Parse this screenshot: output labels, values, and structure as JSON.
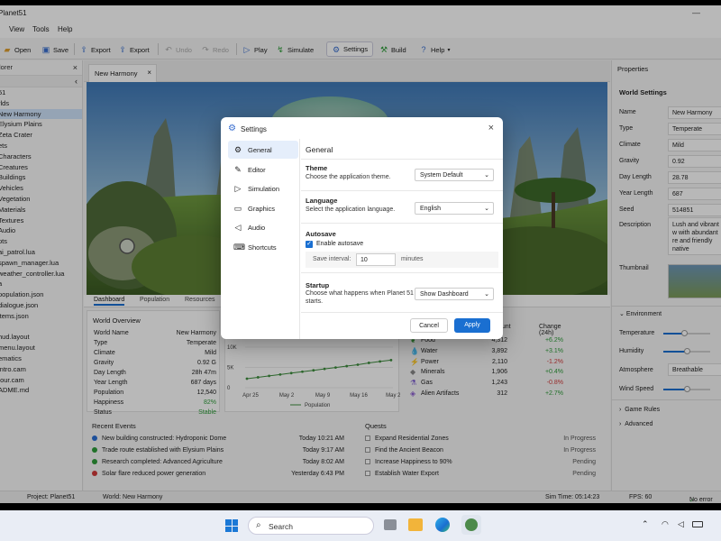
{
  "window": {
    "title": "Planet51"
  },
  "menu": [
    "View",
    "Tools",
    "Help"
  ],
  "toolbar": {
    "open": "Open",
    "save": "Save",
    "export1": "Export",
    "export2": "Export",
    "undo": "Undo",
    "redo": "Redo",
    "play": "Play",
    "simulate": "Simulate",
    "settings": "Settings",
    "build": "Build",
    "help": "Help"
  },
  "explorer": {
    "title": "lorer",
    "items": [
      {
        "label": "51"
      },
      {
        "label": "rlds"
      },
      {
        "label": "New Harmony",
        "selected": true
      },
      {
        "label": "Elysium Plains"
      },
      {
        "label": "Zeta Crater"
      },
      {
        "label": "ets"
      },
      {
        "label": "Characters"
      },
      {
        "label": "Creatures"
      },
      {
        "label": "Buildings"
      },
      {
        "label": "Vehicles"
      },
      {
        "label": "Vegetation"
      },
      {
        "label": "Materials"
      },
      {
        "label": "Textures"
      },
      {
        "label": "Audio"
      },
      {
        "label": "pts"
      },
      {
        "label": "ai_patrol.lua"
      },
      {
        "label": "spawn_manager.lua"
      },
      {
        "label": "weather_controller.lua"
      },
      {
        "label": "a"
      },
      {
        "label": "population.json"
      },
      {
        "label": "dialogue.json"
      },
      {
        "label": "items.json"
      },
      {
        "label": ""
      },
      {
        "label": "hud.layout"
      },
      {
        "label": "menu.layout"
      },
      {
        "label": "ematics"
      },
      {
        "label": "intro.cam"
      },
      {
        "label": "tour.cam"
      },
      {
        "label": "ADME.md"
      }
    ]
  },
  "document": {
    "tab": "New Harmony"
  },
  "bottom": {
    "tabs": [
      "Dashboard",
      "Population",
      "Resources"
    ],
    "overview": {
      "title": "World Overview",
      "rows": [
        {
          "k": "World Name",
          "v": "New Harmony"
        },
        {
          "k": "Type",
          "v": "Temperate"
        },
        {
          "k": "Climate",
          "v": "Mild"
        },
        {
          "k": "Gravity",
          "v": "0.92 G"
        },
        {
          "k": "Day Length",
          "v": "28h 47m"
        },
        {
          "k": "Year Length",
          "v": "687 days"
        },
        {
          "k": "Population",
          "v": "12,540"
        },
        {
          "k": "Happiness",
          "v": "82%"
        },
        {
          "k": "Status",
          "v": "Stable"
        }
      ]
    },
    "chart": {
      "legend": "Population",
      "yticks": [
        "10K",
        "5K",
        "0"
      ],
      "xticks": [
        "Apr 25",
        "May 2",
        "May 9",
        "May 16",
        "May 23"
      ]
    },
    "resources": {
      "headers": [
        "ount",
        "Change (24h)"
      ],
      "rows": [
        {
          "name": "Food",
          "amount": "4,312",
          "change": "+6.2%",
          "color": "#2e9d3a"
        },
        {
          "name": "Water",
          "amount": "3,892",
          "change": "+3.1%",
          "color": "#2e9d3a"
        },
        {
          "name": "Power",
          "amount": "2,110",
          "change": "-1.2%",
          "color": "#d23b3b"
        },
        {
          "name": "Minerals",
          "amount": "1,906",
          "change": "+0.4%",
          "color": "#2e9d3a"
        },
        {
          "name": "Gas",
          "amount": "1,243",
          "change": "-0.8%",
          "color": "#d23b3b"
        },
        {
          "name": "Alien Artifacts",
          "amount": "312",
          "change": "+2.7%",
          "color": "#2e9d3a"
        }
      ]
    },
    "events": {
      "title": "Recent Events",
      "rows": [
        {
          "text": "New building constructed: Hydroponic Dome",
          "time": "Today 10:21 AM",
          "color": "#2a6fd6"
        },
        {
          "text": "Trade route established with Elysium Plains",
          "time": "Today 9:17 AM",
          "color": "#2e9d3a"
        },
        {
          "text": "Research completed: Advanced Agriculture",
          "time": "Today 8:02 AM",
          "color": "#2e9d3a"
        },
        {
          "text": "Solar flare reduced power generation",
          "time": "Yesterday 6:43 PM",
          "color": "#d23b3b"
        }
      ]
    },
    "quests": {
      "title": "Quests",
      "rows": [
        {
          "text": "Expand Residential Zones",
          "status": "In Progress"
        },
        {
          "text": "Find the Ancient Beacon",
          "status": "In Progress"
        },
        {
          "text": "Increase Happiness to 90%",
          "status": "Pending"
        },
        {
          "text": "Establish Water Export",
          "status": "Pending"
        }
      ]
    }
  },
  "properties": {
    "title": "Properties",
    "section": "World Settings",
    "rows": [
      {
        "k": "Name",
        "v": "New Harmony"
      },
      {
        "k": "Type",
        "v": "Temperate"
      },
      {
        "k": "Climate",
        "v": "Mild"
      },
      {
        "k": "Gravity",
        "v": "0.92"
      },
      {
        "k": "Day Length",
        "v": "28.78"
      },
      {
        "k": "Year Length",
        "v": "687"
      },
      {
        "k": "Seed",
        "v": "514851"
      }
    ],
    "description_label": "Description",
    "description": "Lush and vibrant w with abundant re and friendly native",
    "thumbnail_label": "Thumbnail",
    "environment": "Environment",
    "temperature": {
      "label": "Temperature",
      "level": 0.45
    },
    "humidity": {
      "label": "Humidity",
      "level": 0.5
    },
    "atmosphere": {
      "label": "Atmosphere",
      "value": "Breathable"
    },
    "wind": {
      "label": "Wind Speed",
      "level": 0.5
    },
    "game_rules": "Game Rules",
    "advanced": "Advanced"
  },
  "status": {
    "project": "Project: Planet51",
    "world": "World: New Harmony",
    "simtime": "Sim Time: 05:14:23",
    "fps": "FPS: 60",
    "errors": "No error"
  },
  "dialog": {
    "title": "Settings",
    "nav": [
      "General",
      "Editor",
      "Simulation",
      "Graphics",
      "Audio",
      "Shortcuts"
    ],
    "heading": "General",
    "theme": {
      "title": "Theme",
      "desc": "Choose the application theme.",
      "value": "System Default"
    },
    "language": {
      "title": "Language",
      "desc": "Select the application language.",
      "value": "English"
    },
    "autosave": {
      "title": "Autosave",
      "enable": "Enable autosave",
      "interval_label": "Save interval:",
      "interval": "10",
      "unit": "minutes"
    },
    "startup": {
      "title": "Startup",
      "desc1": "Choose what happens when Planet 51",
      "desc2": "starts.",
      "value": "Show Dashboard"
    },
    "cancel": "Cancel",
    "apply": "Apply"
  },
  "taskbar": {
    "search": "Search"
  }
}
